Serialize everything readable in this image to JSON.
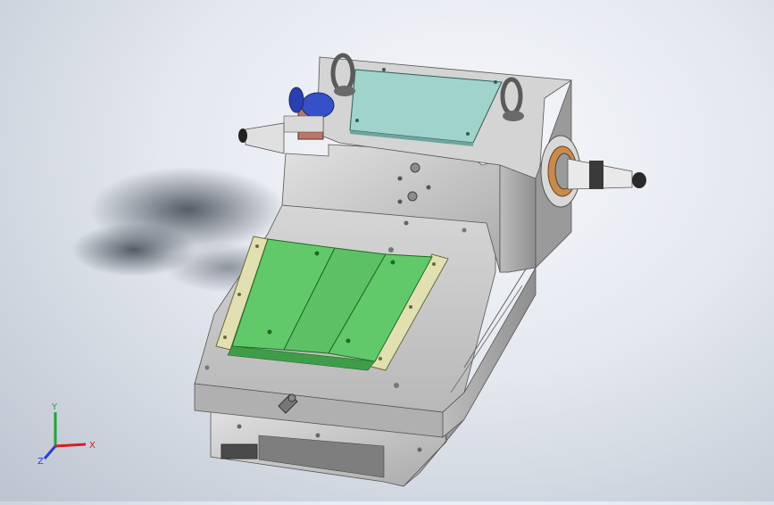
{
  "triad": {
    "x_label": "X",
    "y_label": "Y",
    "z_label": "Z",
    "x_color": "#d42020",
    "y_color": "#1aa830",
    "z_color": "#2240d8"
  },
  "model": {
    "fixture_color": "#62c96a",
    "rail_color": "#e2e0b0",
    "cover_color": "#9fd3cc",
    "body_color": "#c9c9c9",
    "motor_color": "#3550c8",
    "coupling_color": "#b9776a",
    "spindle_ring_color": "#c98a4a"
  }
}
